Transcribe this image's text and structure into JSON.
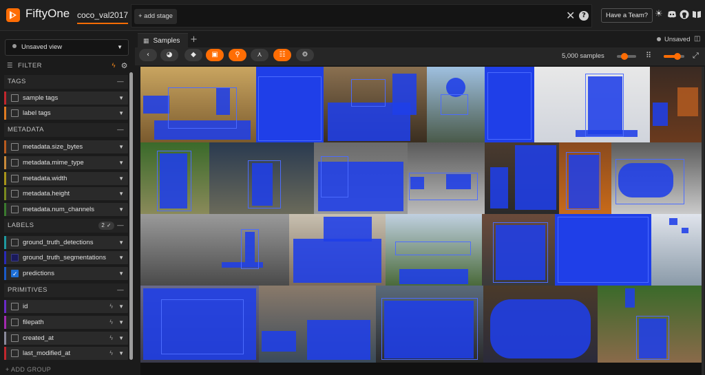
{
  "header": {
    "brand": "FiftyOne",
    "dataset": "coco_val2017",
    "add_stage": "+ add stage",
    "team_button": "Have a Team?",
    "icons": [
      "close-icon",
      "help-icon",
      "sun-icon",
      "discord-icon",
      "github-icon",
      "docs-icon"
    ]
  },
  "sidebar": {
    "view_select": "Unsaved view",
    "filter_label": "FILTER",
    "groups": {
      "tags": "TAGS",
      "metadata": "METADATA",
      "labels": "LABELS",
      "labels_badge": "2 ✓",
      "primitives": "PRIMITIVES"
    },
    "tag_fields": [
      {
        "label": "sample tags",
        "color": "#c2272d"
      },
      {
        "label": "label tags",
        "color": "#e07b21"
      }
    ],
    "metadata_fields": [
      {
        "label": "metadata.size_bytes",
        "color": "#b85a1e"
      },
      {
        "label": "metadata.mime_type",
        "color": "#c98a3a"
      },
      {
        "label": "metadata.width",
        "color": "#a8951a"
      },
      {
        "label": "metadata.height",
        "color": "#7a8a1e"
      },
      {
        "label": "metadata.num_channels",
        "color": "#3a7a2e"
      }
    ],
    "label_fields": [
      {
        "label": "ground_truth_detections",
        "color": "#1e9aa0",
        "state": "unchecked"
      },
      {
        "label": "ground_truth_segmentations",
        "color": "#2a2ab8",
        "state": "dark"
      },
      {
        "label": "predictions",
        "color": "#1a5ac8",
        "state": "checked"
      }
    ],
    "primitive_fields": [
      {
        "label": "id",
        "color": "#6a2ac8"
      },
      {
        "label": "filepath",
        "color": "#a42ab0"
      },
      {
        "label": "created_at",
        "color": "#8a8a9a"
      },
      {
        "label": "last_modified_at",
        "color": "#c2272d"
      }
    ],
    "add_group": "+ ADD GROUP"
  },
  "tabs": {
    "samples": "Samples",
    "plus": "+",
    "unsaved": "Unsaved"
  },
  "toolbar": {
    "buttons": [
      "back-icon",
      "palette-icon",
      "tag-icon",
      "tag-selected-icon",
      "search-icon",
      "patches-icon",
      "list-icon",
      "gear-icon"
    ],
    "sample_count": "5,000 samples",
    "zoom_level": 0.35,
    "grid_size_level": 0.75
  },
  "colors": {
    "accent": "#ff6d04",
    "mask": "#1f3fe8",
    "background": "#1b1b1b"
  }
}
